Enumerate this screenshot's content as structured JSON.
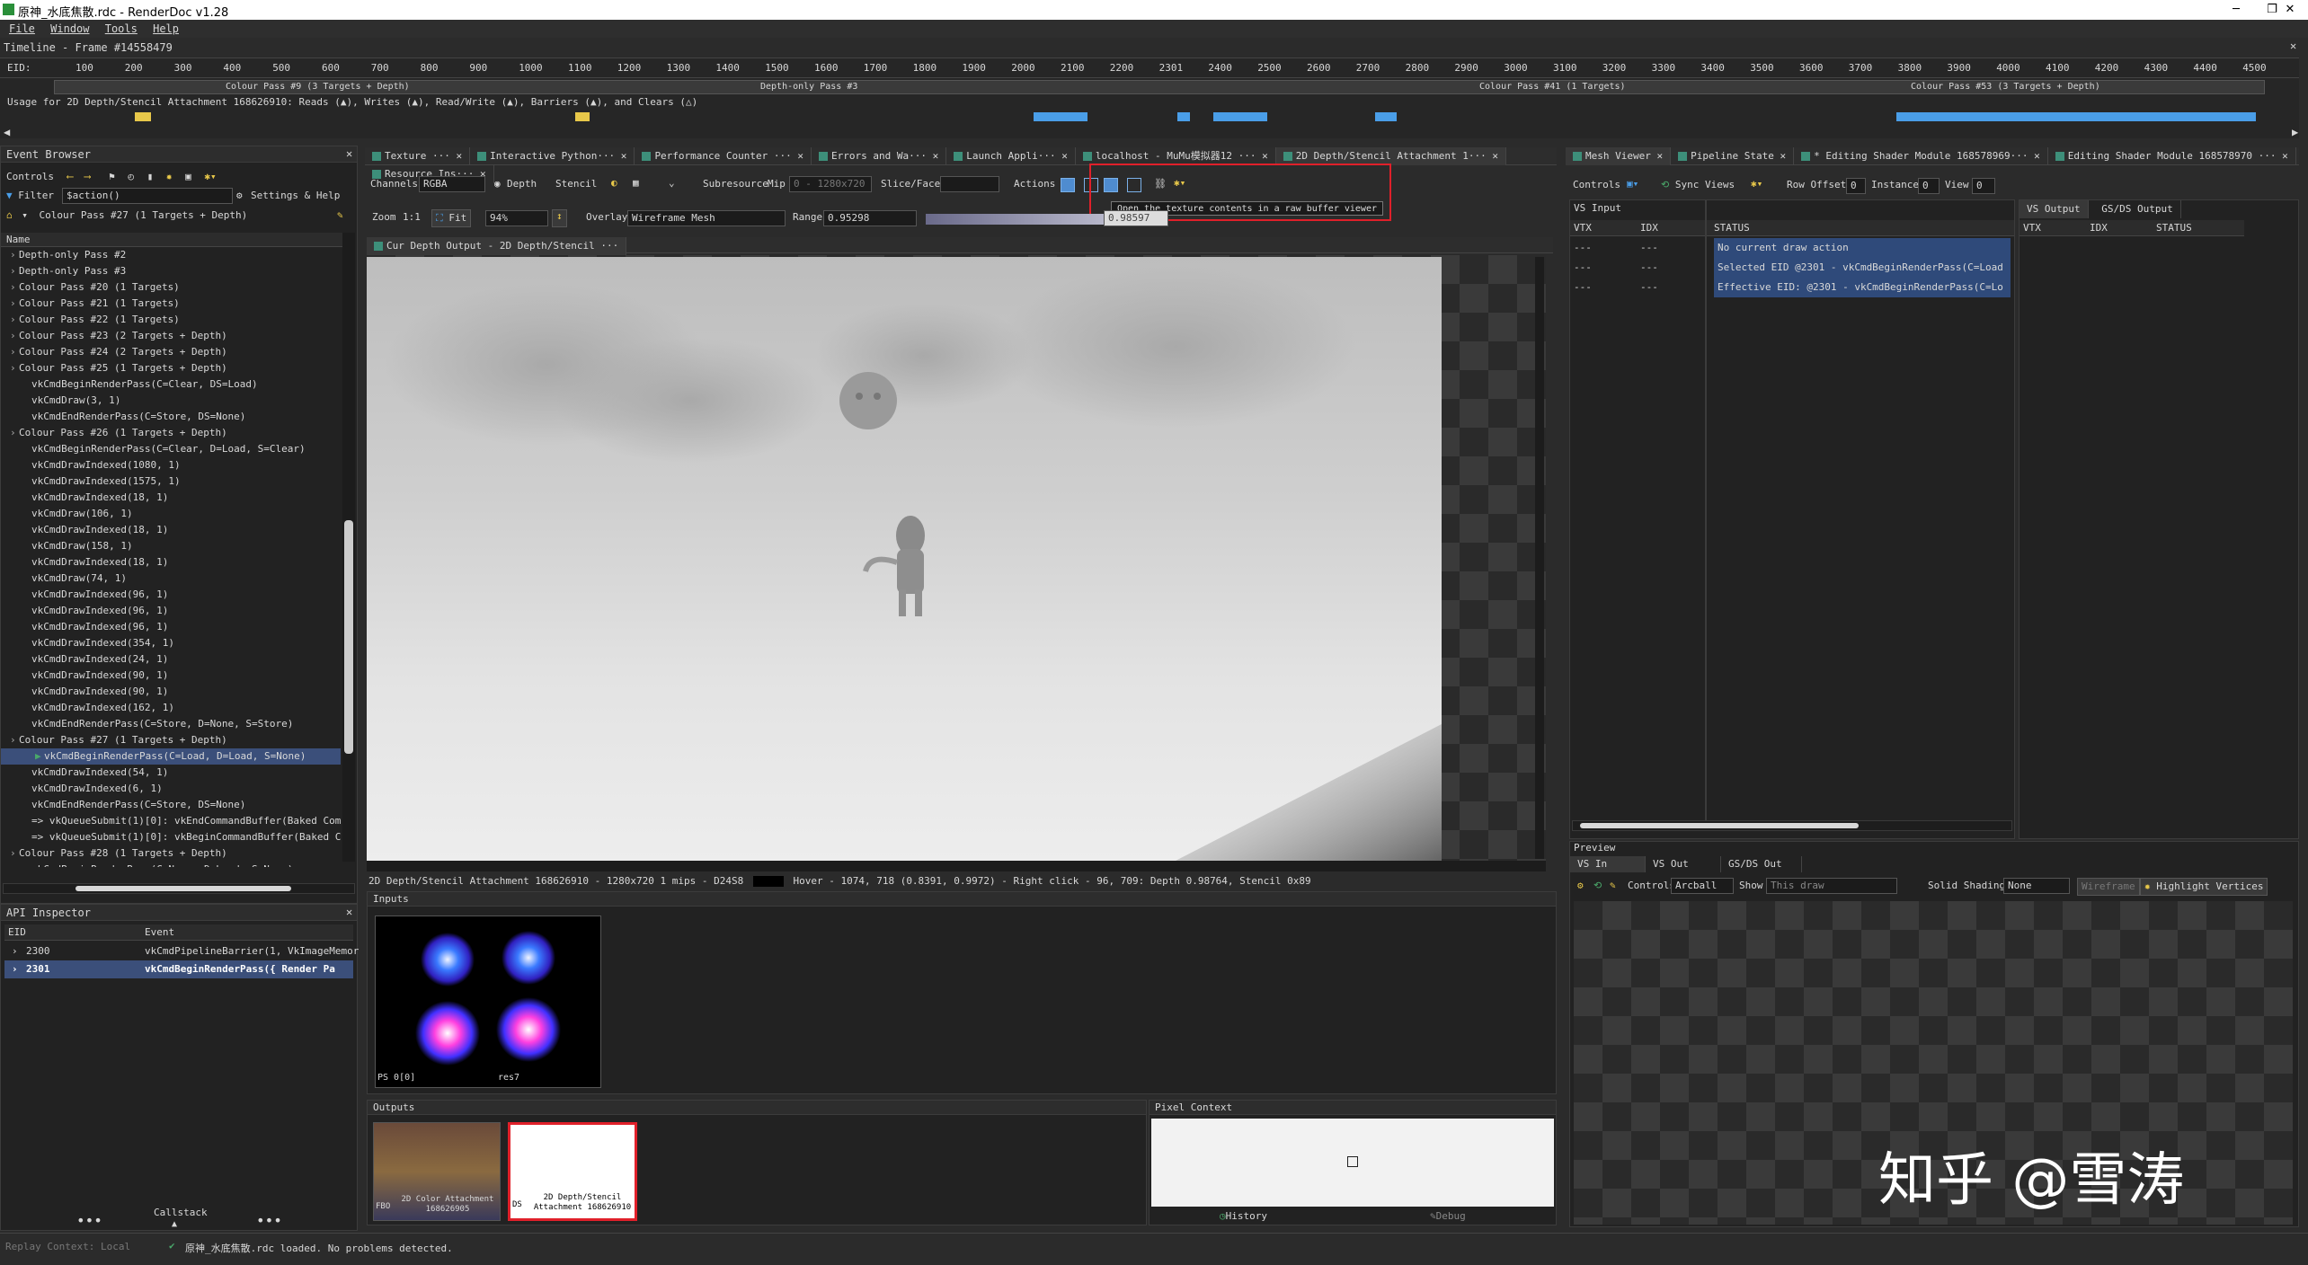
{
  "window": {
    "title": "原神_水底焦散.rdc - RenderDoc v1.28",
    "minimize": "─",
    "maximize": "❐",
    "close": "✕"
  },
  "menu": [
    "File",
    "Window",
    "Tools",
    "Help"
  ],
  "timeline": {
    "title": "Timeline - Frame #14558479",
    "eid_label": "EID:",
    "eid_ticks": [
      "100",
      "200",
      "300",
      "400",
      "500",
      "600",
      "700",
      "800",
      "900",
      "1000",
      "1100",
      "1200",
      "1300",
      "1400",
      "1500",
      "1600",
      "1700",
      "1800",
      "1900",
      "2000",
      "2100",
      "2200",
      "2301",
      "2400",
      "2500",
      "2600",
      "2700",
      "2800",
      "2900",
      "3000",
      "3100",
      "3200",
      "3300",
      "3400",
      "3500",
      "3600",
      "3700",
      "3800",
      "3900",
      "4000",
      "4100",
      "4200",
      "4300",
      "4400",
      "4500"
    ],
    "passes": [
      "Colour Pass #9 (3 Targets + Depth)",
      "Depth-only Pass #3",
      "Colour Pass #41 (1 Targets)",
      "Colour Pass #53 (3 Targets + Depth)"
    ],
    "usage": "Usage for 2D Depth/Stencil Attachment 168626910: Reads (▲), Writes (▲), Read/Write (▲), Barriers (▲), and Clears (△)"
  },
  "event_browser": {
    "title": "Event Browser",
    "controls_label": "Controls",
    "filter_label": "Filter",
    "filter_value": "$action()",
    "settings_label": "Settings & Help",
    "current_pass": "Colour Pass #27 (1 Targets + Depth)",
    "name_header": "Name",
    "items": [
      {
        "text": "Depth-only Pass #2",
        "indent": 1
      },
      {
        "text": "Depth-only Pass #3",
        "indent": 1
      },
      {
        "text": "Colour Pass #20 (1 Targets)",
        "indent": 1
      },
      {
        "text": "Colour Pass #21 (1 Targets)",
        "indent": 1
      },
      {
        "text": "Colour Pass #22 (1 Targets)",
        "indent": 1
      },
      {
        "text": "Colour Pass #23 (2 Targets + Depth)",
        "indent": 1
      },
      {
        "text": "Colour Pass #24 (2 Targets + Depth)",
        "indent": 1
      },
      {
        "text": "Colour Pass #25 (1 Targets + Depth)",
        "indent": 1
      },
      {
        "text": "vkCmdBeginRenderPass(C=Clear, DS=Load)",
        "indent": 2
      },
      {
        "text": "vkCmdDraw(3, 1)",
        "indent": 2
      },
      {
        "text": "vkCmdEndRenderPass(C=Store, DS=None)",
        "indent": 2
      },
      {
        "text": "Colour Pass #26 (1 Targets + Depth)",
        "indent": 1
      },
      {
        "text": "vkCmdBeginRenderPass(C=Clear, D=Load, S=Clear)",
        "indent": 2
      },
      {
        "text": "vkCmdDrawIndexed(1080, 1)",
        "indent": 2
      },
      {
        "text": "vkCmdDrawIndexed(1575, 1)",
        "indent": 2
      },
      {
        "text": "vkCmdDrawIndexed(18, 1)",
        "indent": 2
      },
      {
        "text": "vkCmdDraw(106, 1)",
        "indent": 2
      },
      {
        "text": "vkCmdDrawIndexed(18, 1)",
        "indent": 2
      },
      {
        "text": "vkCmdDraw(158, 1)",
        "indent": 2
      },
      {
        "text": "vkCmdDrawIndexed(18, 1)",
        "indent": 2
      },
      {
        "text": "vkCmdDraw(74, 1)",
        "indent": 2
      },
      {
        "text": "vkCmdDrawIndexed(96, 1)",
        "indent": 2
      },
      {
        "text": "vkCmdDrawIndexed(96, 1)",
        "indent": 2
      },
      {
        "text": "vkCmdDrawIndexed(96, 1)",
        "indent": 2
      },
      {
        "text": "vkCmdDrawIndexed(354, 1)",
        "indent": 2
      },
      {
        "text": "vkCmdDrawIndexed(24, 1)",
        "indent": 2
      },
      {
        "text": "vkCmdDrawIndexed(90, 1)",
        "indent": 2
      },
      {
        "text": "vkCmdDrawIndexed(90, 1)",
        "indent": 2
      },
      {
        "text": "vkCmdDrawIndexed(162, 1)",
        "indent": 2
      },
      {
        "text": "vkCmdEndRenderPass(C=Store, D=None, S=Store)",
        "indent": 2
      },
      {
        "text": "Colour Pass #27 (1 Targets + Depth)",
        "indent": 1
      },
      {
        "text": "vkCmdBeginRenderPass(C=Load, D=Load, S=None)",
        "indent": 3,
        "selected": true
      },
      {
        "text": "vkCmdDrawIndexed(54, 1)",
        "indent": 2
      },
      {
        "text": "vkCmdDrawIndexed(6, 1)",
        "indent": 2
      },
      {
        "text": "vkCmdEndRenderPass(C=Store, DS=None)",
        "indent": 2
      },
      {
        "text": "=> vkQueueSubmit(1)[0]: vkEndCommandBuffer(Baked Comma",
        "indent": 2
      },
      {
        "text": "=> vkQueueSubmit(1)[0]: vkBeginCommandBuffer(Baked Comm",
        "indent": 2
      },
      {
        "text": "Colour Pass #28 (1 Targets + Depth)",
        "indent": 1
      },
      {
        "text": "vkCmdBeginRenderPass(C=None, D=Load, S=None)",
        "indent": 2
      }
    ]
  },
  "api_inspector": {
    "title": "API Inspector",
    "col_eid": "EID",
    "col_event": "Event",
    "rows": [
      {
        "eid": "2300",
        "event": "vkCmdPipelineBarrier(1, VkImageMemor"
      },
      {
        "eid": "2301",
        "event": "vkCmdBeginRenderPass({  Render Pa",
        "selected": true
      }
    ],
    "callstack_label": "Callstack"
  },
  "center_tabs": [
    {
      "label": "Texture ···"
    },
    {
      "label": "Interactive Python···"
    },
    {
      "label": "Performance Counter ···"
    },
    {
      "label": "Errors and Wa···"
    },
    {
      "label": "Launch Appli···"
    },
    {
      "label": "localhost - MuMu模拟器12 ···"
    },
    {
      "label": "2D Depth/Stencil Attachment 1···",
      "active": true
    },
    {
      "label": "Resource Ins···"
    }
  ],
  "texture_toolbar": {
    "channels_label": "Channels",
    "channels_value": "RGBA",
    "depth_label": "Depth",
    "stencil_label": "Stencil",
    "subresource_label": "Subresource",
    "mip_label": "Mip",
    "mip_value": "0 - 1280x720",
    "slice_label": "Slice/Face",
    "actions_label": "Actions",
    "tooltip": "Open the texture contents in a raw buffer viewer",
    "zoom_label": "Zoom",
    "zoom_1to1": "1:1",
    "fit_label": "Fit",
    "zoom_value": "94%",
    "overlay_label": "Overlay",
    "overlay_value": "Wireframe Mesh",
    "range_label": "Range",
    "range_min": "0.95298",
    "range_max": "0.98597"
  },
  "texture_view": {
    "tab_label": "Cur Depth Output - 2D Depth/Stencil ···",
    "status_line": "2D Depth/Stencil Attachment 168626910 - 1280x720 1 mips - D24S8",
    "hover_text": "Hover -   1074,  718 (0.8391, 0.9972)  - Right click -   96,  709: Depth 0.98764, Stencil 0x89"
  },
  "inputs": {
    "title": "Inputs",
    "thumb_label": "PS 0[0]",
    "thumb_name": "res7"
  },
  "outputs": {
    "title": "Outputs",
    "items": [
      {
        "prefix": "FBO",
        "label": "2D Color Attachment 168626905"
      },
      {
        "prefix": "DS",
        "label": "2D Depth/Stencil Attachment 168626910"
      }
    ]
  },
  "pixel_context": {
    "title": "Pixel Context",
    "history_label": "History",
    "debug_label": "Debug"
  },
  "right_tabs": [
    {
      "label": "Mesh Viewer",
      "active": true
    },
    {
      "label": "Pipeline State"
    },
    {
      "label": "* Editing Shader Module 168578969···"
    },
    {
      "label": "Editing Shader Module 168578970 ···"
    }
  ],
  "mesh_viewer": {
    "controls_label": "Controls",
    "sync_views": "Sync Views",
    "row_offset_label": "Row Offset",
    "row_offset_value": "0",
    "instance_label": "Instance",
    "instance_value": "0",
    "view_label": "View",
    "view_value": "0",
    "vs_input_title": "VS Input",
    "vs_output_tab": "VS Output",
    "gsds_output_tab": "GS/DS Output",
    "columns": [
      "VTX",
      "IDX",
      "STATUS"
    ],
    "rows": [
      {
        "vtx": "---",
        "idx": "---",
        "status": "No current draw action"
      },
      {
        "vtx": "---",
        "idx": "---",
        "status": "Selected EID @2301 - vkCmdBeginRenderPass(C=Load"
      },
      {
        "vtx": "---",
        "idx": "---",
        "status": "Effective EID: @2301 - vkCmdBeginRenderPass(C=Lo"
      }
    ],
    "preview_title": "Preview",
    "preview_tabs": [
      "VS In",
      "VS Out",
      "GS/DS Out"
    ],
    "camera_label": "Controls",
    "camera_value": "Arcball",
    "show_label": "Show",
    "show_value": "This draw",
    "solid_label": "Solid Shading",
    "solid_value": "None",
    "wireframe_label": "Wireframe",
    "highlight_label": "Highlight Vertices"
  },
  "status": {
    "replay_context": "Replay Context: Local",
    "message": "原神_水底焦散.rdc loaded. No problems detected."
  },
  "watermark": "知乎 @雪涛",
  "colors": {
    "accent_blue": "#4a9ee8",
    "selection": "#3b4f7a",
    "highlight_red": "#e0202a",
    "status_selected": "#2f4a7a"
  }
}
